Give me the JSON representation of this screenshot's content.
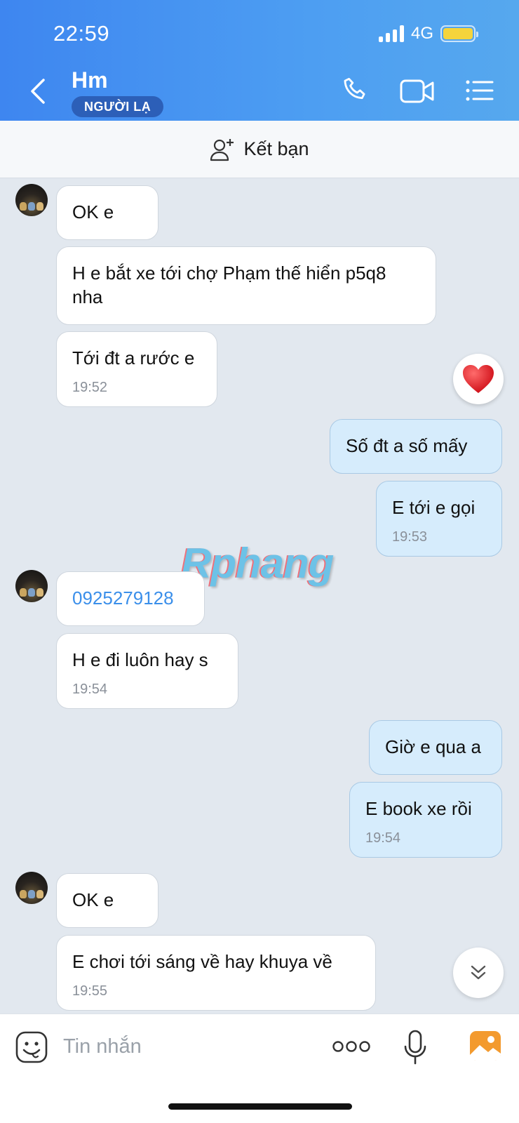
{
  "status_bar": {
    "time": "22:59",
    "network": "4G"
  },
  "header": {
    "title": "Hm",
    "badge": "NGƯỜI LẠ"
  },
  "friend_bar": {
    "label": "Kết bạn"
  },
  "messages": [
    {
      "text": "OK e"
    },
    {
      "text": "H e bắt xe tới chợ Phạm thế hiển p5q8 nha"
    },
    {
      "text": "Tới đt a rước e",
      "time": "19:52"
    },
    {
      "text": "Số đt a số mấy"
    },
    {
      "text": "E tới e gọi",
      "time": "19:53"
    },
    {
      "text": "0925279128"
    },
    {
      "text": "H e đi luôn hay s",
      "time": "19:54"
    },
    {
      "text": "Giờ e qua a"
    },
    {
      "text": "E book xe rồi",
      "time": "19:54"
    },
    {
      "text": "OK e"
    },
    {
      "text": "E chơi tới sáng về hay khuya về",
      "time": "19:55"
    }
  ],
  "watermark": "Rphang",
  "input": {
    "placeholder": "Tin nhắn"
  },
  "icons": [
    "back-icon",
    "phone-icon",
    "video-call-icon",
    "menu-icon",
    "add-friend-icon",
    "heart-icon",
    "scroll-down-icon",
    "sticker-icon",
    "more-icon",
    "microphone-icon",
    "image-icon"
  ],
  "colors": {
    "header": "#4a96f1",
    "outgoing_bubble": "#d6ecfc",
    "incoming_bubble": "#ffffff",
    "badge": "#2c5fb8",
    "link": "#3b8fea"
  }
}
